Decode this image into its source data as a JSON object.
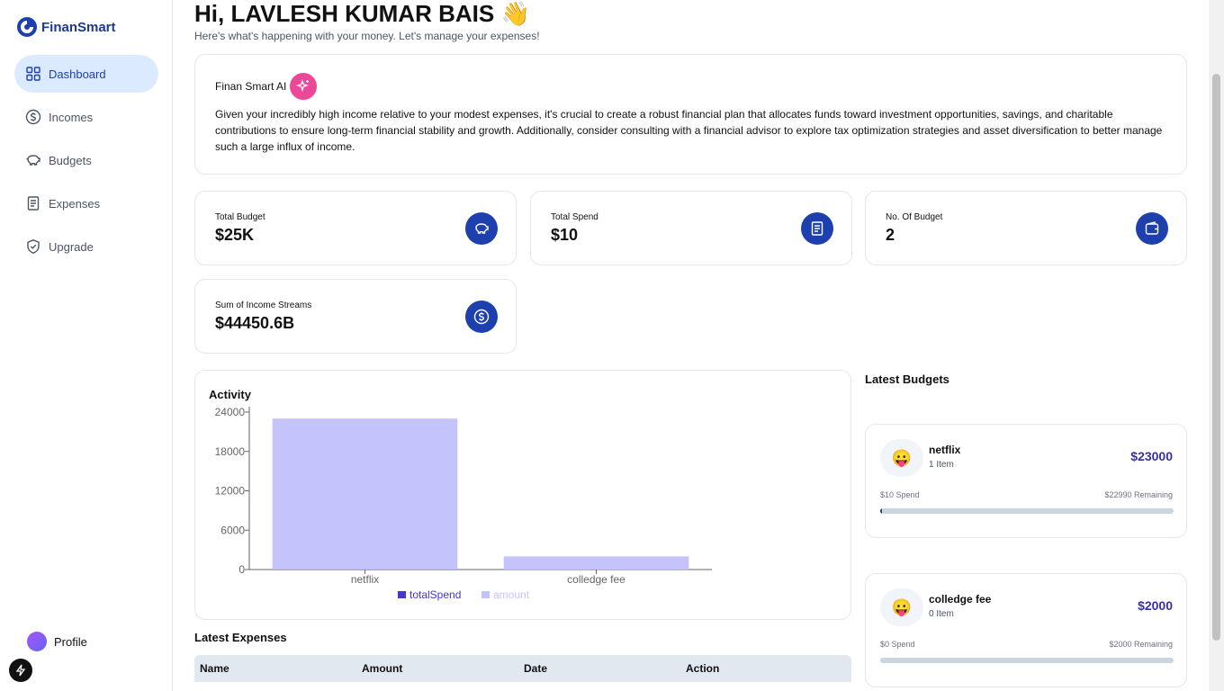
{
  "app": {
    "name": "FinanSmart"
  },
  "sidebar": {
    "items": [
      {
        "label": "Dashboard",
        "icon": "dashboard-icon",
        "active": true
      },
      {
        "label": "Incomes",
        "icon": "dollar-circle-icon"
      },
      {
        "label": "Budgets",
        "icon": "piggy-bank-icon"
      },
      {
        "label": "Expenses",
        "icon": "receipt-icon"
      },
      {
        "label": "Upgrade",
        "icon": "shield-check-icon"
      }
    ],
    "profile_label": "Profile"
  },
  "header": {
    "greeting": "Hi, LAVLESH KUMAR BAIS",
    "wave": "👋",
    "subtitle": "Here's what's happening with your money. Let's manage your expenses!"
  },
  "ai": {
    "title": "Finan Smart AI",
    "text": "Given your incredibly high income relative to your modest expenses, it's crucial to create a robust financial plan that allocates funds toward investment opportunities, savings, and charitable contributions to ensure long-term financial stability and growth. Additionally, consider consulting with a financial advisor to explore tax optimization strategies and asset diversification to better manage such a large influx of income."
  },
  "stats": [
    {
      "label": "Total Budget",
      "value": "$25K",
      "icon": "piggy-bank-icon"
    },
    {
      "label": "Total Spend",
      "value": "$10",
      "icon": "receipt-icon"
    },
    {
      "label": "No. Of Budget",
      "value": "2",
      "icon": "wallet-icon"
    },
    {
      "label": "Sum of Income Streams",
      "value": "$44450.6B",
      "icon": "dollar-circle-icon"
    }
  ],
  "activity": {
    "title": "Activity"
  },
  "chart_data": {
    "type": "bar",
    "categories": [
      "netflix",
      "colledge fee"
    ],
    "series": [
      {
        "name": "totalSpend",
        "values": [
          10,
          0
        ],
        "color": "#4338ca"
      },
      {
        "name": "amount",
        "values": [
          23000,
          2000
        ],
        "color": "#c4c3fb"
      }
    ],
    "yticks": [
      "0",
      "6000",
      "12000",
      "18000",
      "24000"
    ],
    "ylim": [
      0,
      24000
    ],
    "legend": "bottom",
    "stacked": true
  },
  "latest_expenses": {
    "title": "Latest Expenses",
    "columns": [
      "Name",
      "Amount",
      "Date",
      "Action"
    ]
  },
  "latest_budgets": {
    "title": "Latest Budgets",
    "items": [
      {
        "emoji": "😛",
        "name": "netflix",
        "items": "1 Item",
        "amount": "$23000",
        "spend": "$10 Spend",
        "remaining": "$22990 Remaining",
        "progress": 0.0004
      },
      {
        "emoji": "😛",
        "name": "colledge fee",
        "items": "0 Item",
        "amount": "$2000",
        "spend": "$0 Spend",
        "remaining": "$2000 Remaining",
        "progress": 0
      }
    ]
  },
  "colors": {
    "accent": "#1e40af",
    "active_bg": "#dbeafe",
    "bar": "#c4c3fb"
  }
}
